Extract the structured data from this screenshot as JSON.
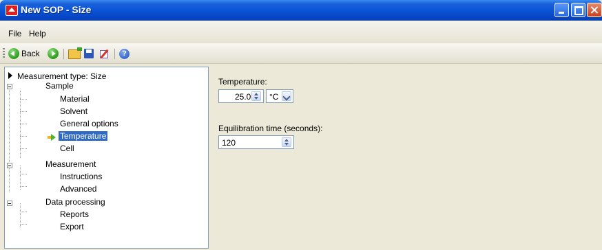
{
  "window": {
    "title": "New SOP - Size"
  },
  "menu": {
    "file": "File",
    "help": "Help"
  },
  "toolbar": {
    "back_label": "Back"
  },
  "tree": {
    "root": "Measurement type: Size",
    "groups": [
      {
        "label": "Sample",
        "items": [
          "Material",
          "Solvent",
          "General options",
          "Temperature",
          "Cell"
        ]
      },
      {
        "label": "Measurement",
        "items": [
          "Instructions",
          "Advanced"
        ]
      },
      {
        "label": "Data processing",
        "items": [
          "Reports",
          "Export"
        ]
      }
    ],
    "selected": "Temperature"
  },
  "form": {
    "temperature_label": "Temperature:",
    "temperature_value": "25.0",
    "temperature_unit": "°C",
    "equilibration_label": "Equilibration time (seconds):",
    "equilibration_value": "120"
  }
}
